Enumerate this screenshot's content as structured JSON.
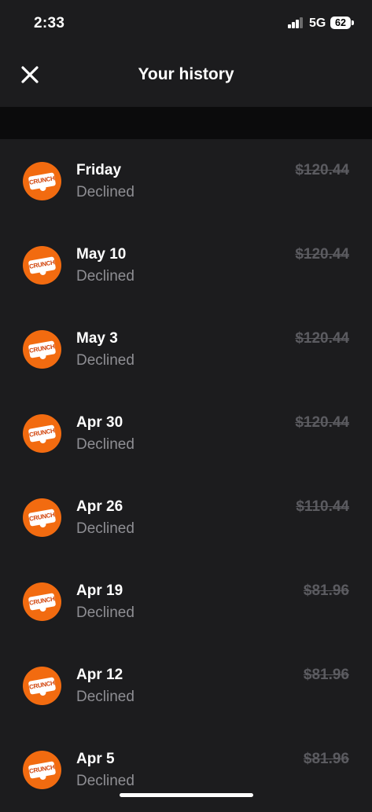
{
  "status_bar": {
    "time": "2:33",
    "network": "5G",
    "battery": "62"
  },
  "header": {
    "title": "Your history",
    "close_icon": "close-icon"
  },
  "merchant_logo_text": "CRUNCH",
  "transactions": [
    {
      "date": "Friday",
      "status": "Declined",
      "amount": "$120.44"
    },
    {
      "date": "May 10",
      "status": "Declined",
      "amount": "$120.44"
    },
    {
      "date": "May 3",
      "status": "Declined",
      "amount": "$120.44"
    },
    {
      "date": "Apr 30",
      "status": "Declined",
      "amount": "$120.44"
    },
    {
      "date": "Apr 26",
      "status": "Declined",
      "amount": "$110.44"
    },
    {
      "date": "Apr 19",
      "status": "Declined",
      "amount": "$81.96"
    },
    {
      "date": "Apr 12",
      "status": "Declined",
      "amount": "$81.96"
    },
    {
      "date": "Apr 5",
      "status": "Declined",
      "amount": "$81.96"
    }
  ],
  "colors": {
    "background": "#1c1c1e",
    "avatar": "#f26b10",
    "muted_text": "#8e8e93",
    "amount_text": "#5b5b60"
  }
}
